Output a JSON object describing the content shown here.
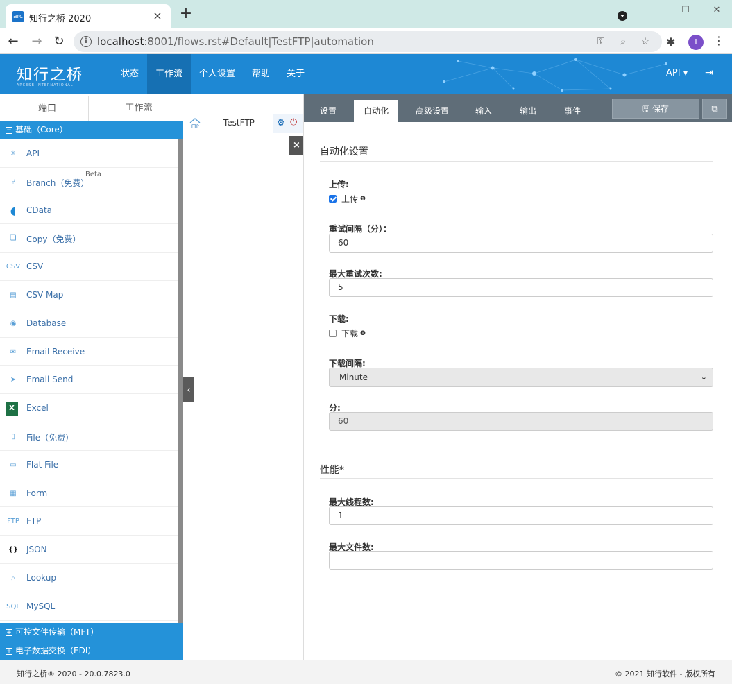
{
  "browser": {
    "tab_title": "知行之桥 2020",
    "favicon_text": "arc",
    "url_host": "localhost",
    "url_rest": ":8001/flows.rst#Default|TestFTP|automation"
  },
  "header": {
    "logo_main": "知行之桥",
    "logo_sub": "ARCESB INTERNATIONAL",
    "nav": [
      "状态",
      "工作流",
      "个人设置",
      "帮助",
      "关于"
    ],
    "active_nav": "工作流",
    "api_menu": "API ▾"
  },
  "left": {
    "tabs": [
      "端口",
      "工作流"
    ],
    "core_group": "基础（Core）",
    "connectors": [
      {
        "label": "API",
        "icon": "api-icon"
      },
      {
        "label": "Branch（免费）",
        "icon": "branch-icon",
        "badge": "Beta"
      },
      {
        "label": "CData",
        "icon": "cdata-icon"
      },
      {
        "label": "Copy（免费）",
        "icon": "copy-icon"
      },
      {
        "label": "CSV",
        "icon": "csv-icon"
      },
      {
        "label": "CSV Map",
        "icon": "csv-map-icon"
      },
      {
        "label": "Database",
        "icon": "database-icon"
      },
      {
        "label": "Email Receive",
        "icon": "email-receive-icon"
      },
      {
        "label": "Email Send",
        "icon": "email-send-icon"
      },
      {
        "label": "Excel",
        "icon": "excel-icon"
      },
      {
        "label": "File（免费）",
        "icon": "file-icon"
      },
      {
        "label": "Flat File",
        "icon": "flat-file-icon"
      },
      {
        "label": "Form",
        "icon": "form-icon"
      },
      {
        "label": "FTP",
        "icon": "ftp-icon"
      },
      {
        "label": "JSON",
        "icon": "json-icon"
      },
      {
        "label": "Lookup",
        "icon": "lookup-icon"
      },
      {
        "label": "MySQL",
        "icon": "mysql-icon"
      }
    ],
    "mft_group": "可控文件传输（MFT）",
    "edi_group": "电子数据交换（EDI）"
  },
  "flow": {
    "node_label": "TestFTP"
  },
  "settings": {
    "tabs": [
      "设置",
      "自动化",
      "高级设置",
      "输入",
      "输出",
      "事件"
    ],
    "active_tab": "自动化",
    "save_label": "保存",
    "section_automation": "自动化设置",
    "upload_label": "上传:",
    "upload_check": "上传",
    "upload_checked": true,
    "retry_interval_label": "重试间隔（分）：",
    "retry_interval_value": "60",
    "max_retries_label": "最大重试次数:",
    "max_retries_value": "5",
    "download_label": "下载:",
    "download_check": "下载",
    "download_checked": false,
    "download_interval_label": "下载间隔:",
    "download_interval_value": "Minute",
    "minutes_label": "分:",
    "minutes_value": "60",
    "section_performance": "性能*",
    "max_threads_label": "最大线程数:",
    "max_threads_value": "1",
    "max_files_label": "最大文件数:",
    "max_files_value": ""
  },
  "footer": {
    "left": "知行之桥® 2020 - 20.0.7823.0",
    "right": "© 2021 知行软件 - 版权所有"
  }
}
